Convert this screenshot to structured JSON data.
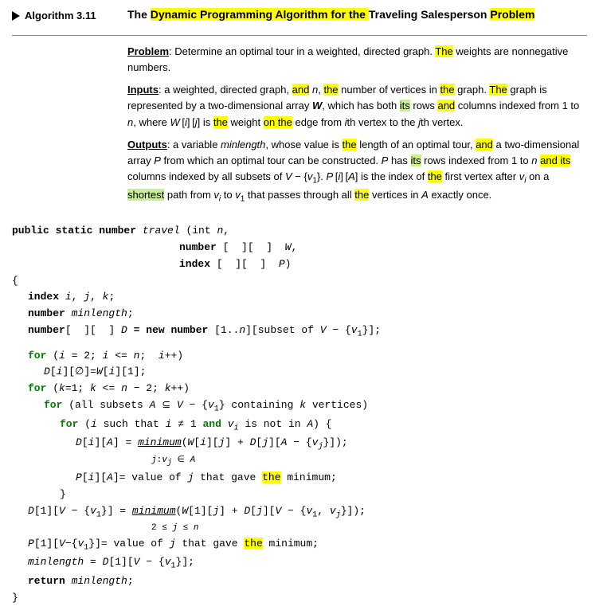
{
  "algorithm": {
    "label": "Algorithm 3.11",
    "title_parts": [
      {
        "text": "The ",
        "bold": true
      },
      {
        "text": "Dynamic Programming Algorithm for the ",
        "bold": true,
        "highlight": "yellow"
      },
      {
        "text": "Traveling Salesperson ",
        "bold": true
      },
      {
        "text": "Problem",
        "bold": true,
        "highlight": "yellow"
      }
    ],
    "problem_label": "Problem:",
    "problem_text": " Determine an optimal tour in a weighted, directed graph. The weights are nonnegative numbers.",
    "inputs_label": "Inputs:",
    "outputs_label": "Outputs:",
    "inputs_text": " a weighted, directed graph, and n, the number of vertices in the graph. The graph is represented by a two-dimensional array W, which has both its rows and columns indexed from 1 to n, where W[i][j] is the weight on the edge from ith vertex to the jth vertex.",
    "outputs_text": " a variable minlength, whose value is the length of an optimal tour, and a two-dimensional array P from which an optimal tour can be constructed. P has its rows indexed from 1 to n and its columns indexed by all subsets of V − {v1}. P[i][A] is the index of the first vertex after vi on a shortest path from vi to v1 that passes through all the vertices in A exactly once."
  },
  "code": {
    "signature": "public static number travel (int n,",
    "param2": "number [  ][  ]  W,",
    "param3": "index [  ][  ]  P)",
    "body": [
      "{",
      "  index i, j, k;",
      "  number minlength;",
      "  number [  ][  ] D = new number [1..n][subset of V − {v1}];",
      "",
      "  for (i = 2; i <= n; i++)",
      "    D[i][∅]=W[i][1];",
      "  for (k=1; k <= n − 2; k++)",
      "    for (all subsets A ⊆ V − {v1} containing k vertices)",
      "      for (i such that i ≠ 1 and vi is not in A) {",
      "        D[i][A] = minimum(W[i][j] + D[j][A − {vj}]);",
      "                  j:vj ∈ A",
      "        P[i][A]= value of j that gave the minimum;",
      "      }",
      "  D[1][V − {v1}] = minimum(W[1][j] + D[j][V − {v1, vj}]);",
      "                    2 ≤ j ≤ n",
      "  P[1][V−{v1}]= value of j that gave the minimum;",
      "  minlength = D[1][V − {v1}];",
      "  return minlength;",
      "}"
    ]
  }
}
